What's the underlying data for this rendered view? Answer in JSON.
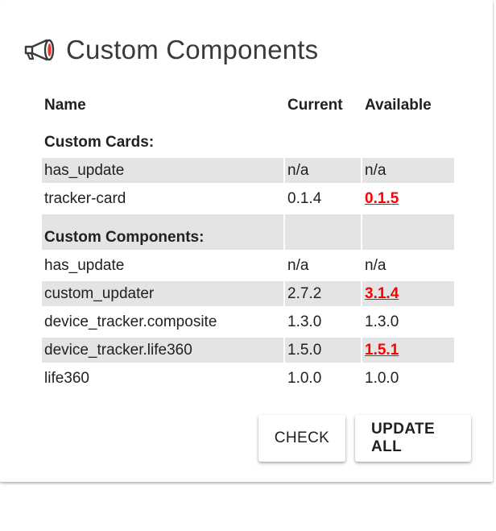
{
  "card": {
    "title": "Custom Components",
    "icon": "megaphone-icon"
  },
  "table": {
    "headers": {
      "name": "Name",
      "current": "Current",
      "available": "Available"
    },
    "sections": [
      {
        "label": "Custom Cards:",
        "rows": [
          {
            "name": "has_update",
            "current": "n/a",
            "available": "n/a",
            "update": false
          },
          {
            "name": "tracker-card",
            "current": "0.1.4",
            "available": "0.1.5",
            "update": true
          }
        ]
      },
      {
        "label": "Custom Components:",
        "rows": [
          {
            "name": "has_update",
            "current": "n/a",
            "available": "n/a",
            "update": false
          },
          {
            "name": "custom_updater",
            "current": "2.7.2",
            "available": "3.1.4",
            "update": true
          },
          {
            "name": "device_tracker.composite",
            "current": "1.3.0",
            "available": "1.3.0",
            "update": false
          },
          {
            "name": "device_tracker.life360",
            "current": "1.5.0",
            "available": "1.5.1",
            "update": true
          },
          {
            "name": "life360",
            "current": "1.0.0",
            "available": "1.0.0",
            "update": false
          }
        ]
      }
    ]
  },
  "actions": {
    "check_label": "CHECK",
    "update_all_label": "UPDATE ALL"
  },
  "colors": {
    "update_available": "#ff0000",
    "row_shade": "#e4e4e4",
    "icon_accent": "#e53935"
  }
}
